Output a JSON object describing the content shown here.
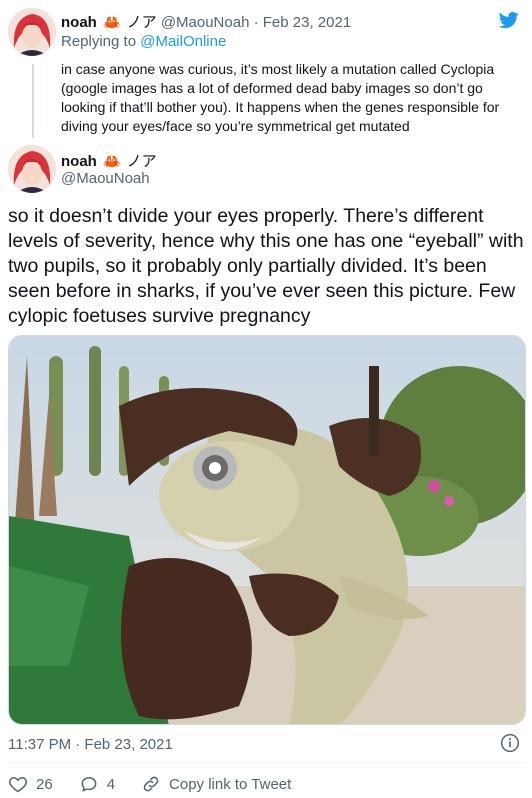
{
  "parent_tweet": {
    "display_name": "noah",
    "name_suffix": "ノア",
    "handle": "@MaouNoah",
    "separator": "·",
    "date": "Feb 23, 2021",
    "replying_to_label": "Replying to",
    "replying_to_mention": "@MailOnline",
    "text": "in case anyone was curious, it’s most likely a mutation called Cyclopia (google images has a lot of deformed dead baby images so don’t go looking if that’ll bother you). It happens when the genes responsible for diving your eyes/face so you’re symmetrical get mutated"
  },
  "main_tweet": {
    "display_name": "noah",
    "name_suffix": "ノア",
    "handle": "@MaouNoah",
    "text": "so it doesn’t divide your eyes properly. There’s different levels of severity, hence why this one has one “eyeball” with two pupils, so it probably only partially divided. It’s been seen before in sharks, if you’ve ever seen this picture. Few cylopic foetuses survive pregnancy",
    "timestamp": "11:37 PM · Feb 23, 2021"
  },
  "actions": {
    "like_count": "26",
    "reply_count": "4",
    "copy_link_label": "Copy link to Tweet"
  },
  "icons": {
    "brand": "twitter-bird-icon",
    "crab": "crab-icon",
    "info": "info-icon",
    "like": "heart-icon",
    "reply": "comment-icon",
    "link": "link-icon"
  },
  "colors": {
    "brand_blue": "#1d9bf0",
    "secondary_text": "#536471",
    "crab_red": "#d62b2b"
  }
}
